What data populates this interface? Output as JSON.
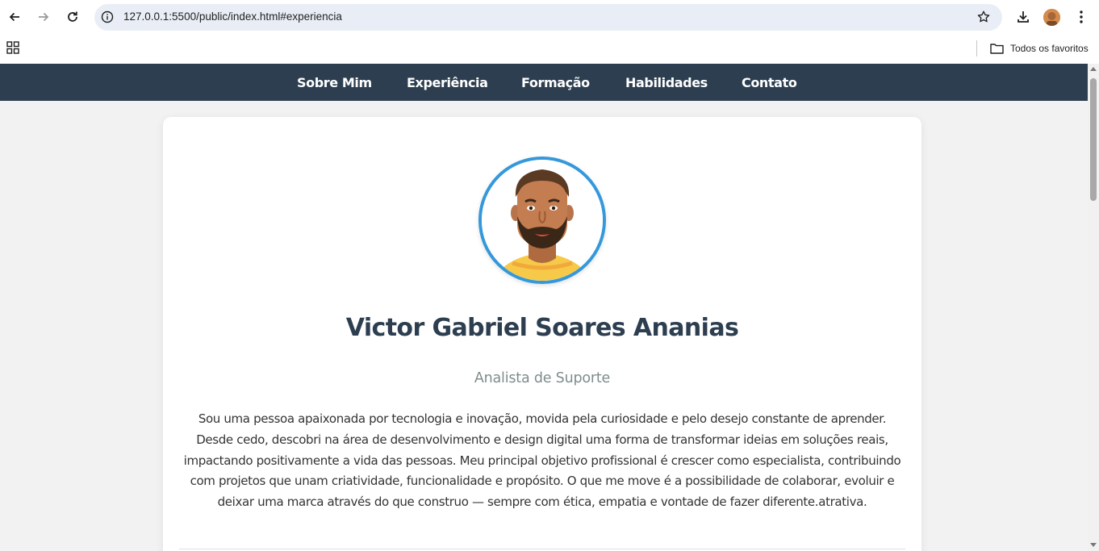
{
  "browser": {
    "url": "127.0.0.1:5500/public/index.html#experiencia",
    "bookmarks_folder": "Todos os favoritos"
  },
  "site": {
    "nav": [
      "Sobre Mim",
      "Experiência",
      "Formação",
      "Habilidades",
      "Contato"
    ],
    "profile": {
      "name": "Victor Gabriel Soares Ananias",
      "role": "Analista de Suporte",
      "bio": "Sou uma pessoa apaixonada por tecnologia e inovação, movida pela curiosidade e pelo desejo constante de aprender. Desde cedo, descobri na área de desenvolvimento e design digital uma forma de transformar ideias em soluções reais, impactando positivamente a vida das pessoas. Meu principal objetivo profissional é crescer como especialista, contribuindo com projetos que unam criatividade, funcionalidade e propósito. O que me move é a possibilidade de colaborar, evoluir e deixar uma marca através do que construo — sempre com ética, empatia e vontade de fazer diferente.atrativa."
    }
  },
  "colors": {
    "nav_bg": "#2c3e50",
    "accent": "#3498db",
    "title": "#2c3e50",
    "subtitle": "#7f8c8d"
  },
  "icons": {
    "back": "arrow-left-icon",
    "forward": "arrow-right-icon",
    "reload": "reload-icon",
    "info": "info-icon",
    "bookmark": "star-icon",
    "download": "download-icon",
    "menu": "more-vertical-icon",
    "apps": "apps-grid-icon",
    "folder": "folder-icon"
  }
}
